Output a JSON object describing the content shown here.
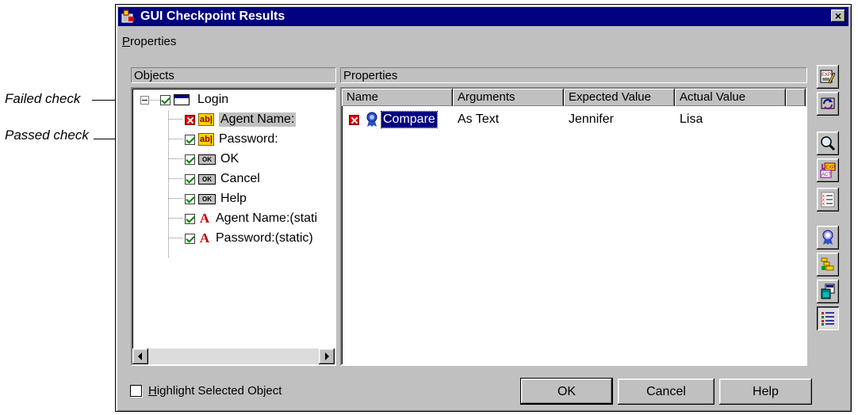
{
  "callouts": {
    "failed": "Failed check",
    "passed": "Passed check"
  },
  "window": {
    "title": "GUI Checkpoint Results",
    "close_symbol": "×",
    "menu": [
      {
        "label_underlined": "P",
        "label_rest": "roperties"
      }
    ]
  },
  "objects_panel": {
    "header": "Objects",
    "items": [
      {
        "label": "Login",
        "status": "pass",
        "icon": "window-icon"
      },
      {
        "label": "Agent Name:",
        "status": "fail",
        "icon": "edit-field-icon"
      },
      {
        "label": "Password:",
        "status": "pass",
        "icon": "edit-field-icon"
      },
      {
        "label": "OK",
        "status": "pass",
        "icon": "push-button-icon"
      },
      {
        "label": "Cancel",
        "status": "pass",
        "icon": "push-button-icon"
      },
      {
        "label": "Help",
        "status": "pass",
        "icon": "push-button-icon"
      },
      {
        "label": "Agent Name:(stati",
        "status": "pass",
        "icon": "static-text-icon"
      },
      {
        "label": "Password:(static)",
        "status": "pass",
        "icon": "static-text-icon"
      }
    ],
    "edit_icon_text": "ab|",
    "button_icon_text": "OK",
    "static_icon_text": "A"
  },
  "properties_panel": {
    "header": "Properties",
    "columns": [
      "Name",
      "Arguments",
      "Expected Value",
      "Actual Value"
    ],
    "rows": [
      {
        "status": "fail",
        "name": "Compare",
        "arguments": "As Text",
        "expected": "Jennifer",
        "actual": "Lisa"
      }
    ]
  },
  "footer": {
    "highlight_underlined": "H",
    "highlight_rest": "ighlight Selected Object",
    "buttons": {
      "ok": "OK",
      "cancel": "Cancel",
      "help": "Help"
    }
  },
  "toolbar": {
    "icons": [
      "edit-expected-icon",
      "update-icon",
      "zoom-icon",
      "expected-actual-icon",
      "compare-icon",
      "specify-args-icon",
      "stack-icon",
      "copy-icon",
      "checklist-icon"
    ],
    "exp_text": "EXP",
    "act_text": "ACT"
  },
  "colors": {
    "titlebar": "#000080",
    "window": "#c0c0c0",
    "fail": "#e00000",
    "pass": "#008000"
  }
}
